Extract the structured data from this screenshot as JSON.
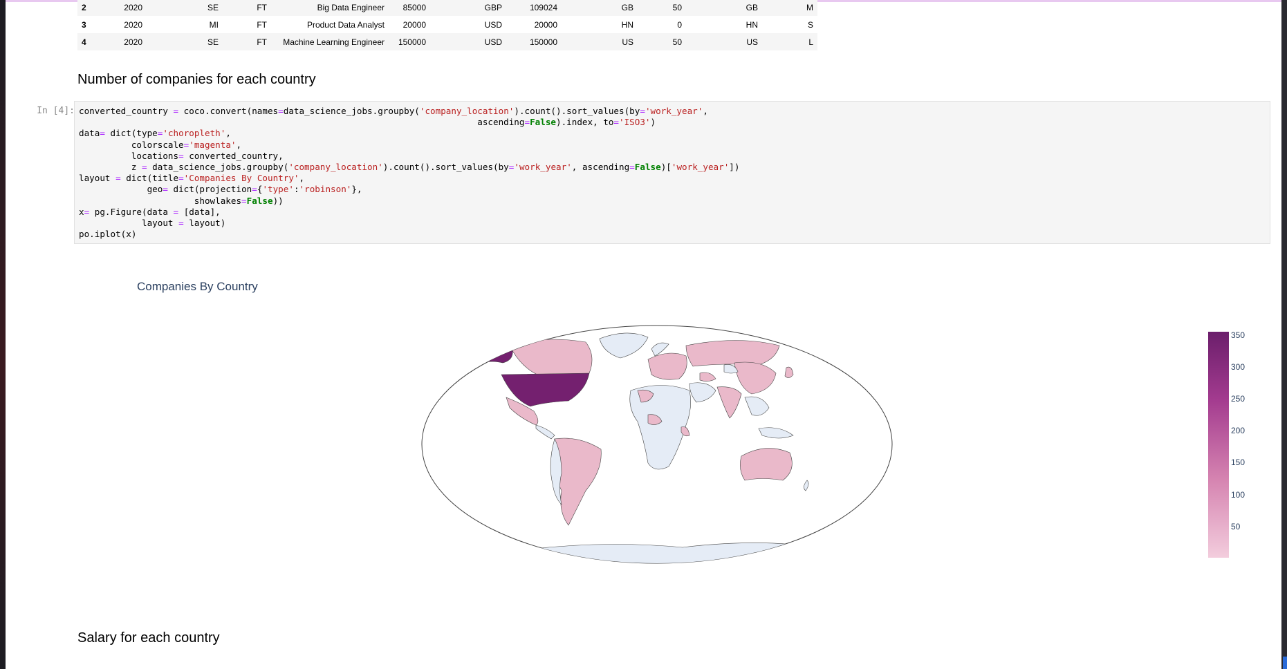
{
  "dataframe": {
    "rows": [
      [
        "2",
        "2020",
        "SE",
        "FT",
        "Big Data Engineer",
        "85000",
        "GBP",
        "109024",
        "GB",
        "50",
        "GB",
        "M"
      ],
      [
        "3",
        "2020",
        "MI",
        "FT",
        "Product Data Analyst",
        "20000",
        "USD",
        "20000",
        "HN",
        "0",
        "HN",
        "S"
      ],
      [
        "4",
        "2020",
        "SE",
        "FT",
        "Machine Learning Engineer",
        "150000",
        "USD",
        "150000",
        "US",
        "50",
        "US",
        "L"
      ]
    ]
  },
  "sections": {
    "companies_heading": "Number of companies for each country",
    "salary_heading": "Salary for each country"
  },
  "cell": {
    "prompt": "In [4]:"
  },
  "code_lines": [
    [
      [
        "converted_country ",
        ""
      ],
      [
        "=",
        "op"
      ],
      [
        " coco.convert(names",
        ""
      ],
      [
        "=",
        "op"
      ],
      [
        "data_science_jobs.groupby(",
        ""
      ],
      [
        "'company_location'",
        "st"
      ],
      [
        ").count().sort_values(by",
        ""
      ],
      [
        "=",
        "op"
      ],
      [
        "'work_year'",
        "st"
      ],
      [
        ",",
        ""
      ]
    ],
    [
      [
        "                                                                            ascending",
        ""
      ],
      [
        "=",
        "op"
      ],
      [
        "False",
        "kw"
      ],
      [
        ").index, to",
        ""
      ],
      [
        "=",
        "op"
      ],
      [
        "'ISO3'",
        "st"
      ],
      [
        ")",
        ""
      ]
    ],
    [
      [
        "data",
        ""
      ],
      [
        "=",
        "op"
      ],
      [
        " dict(type",
        ""
      ],
      [
        "=",
        "op"
      ],
      [
        "'choropleth'",
        "st"
      ],
      [
        ",",
        ""
      ]
    ],
    [
      [
        "          colorscale",
        ""
      ],
      [
        "=",
        "op"
      ],
      [
        "'magenta'",
        "st"
      ],
      [
        ",",
        ""
      ]
    ],
    [
      [
        "          locations",
        ""
      ],
      [
        "=",
        "op"
      ],
      [
        " converted_country,",
        ""
      ]
    ],
    [
      [
        "          z ",
        ""
      ],
      [
        "=",
        "op"
      ],
      [
        " data_science_jobs.groupby(",
        ""
      ],
      [
        "'company_location'",
        "st"
      ],
      [
        ").count().sort_values(by",
        ""
      ],
      [
        "=",
        "op"
      ],
      [
        "'work_year'",
        "st"
      ],
      [
        ", ascending",
        ""
      ],
      [
        "=",
        "op"
      ],
      [
        "False",
        "kw"
      ],
      [
        ")[",
        ""
      ],
      [
        "'work_year'",
        "st"
      ],
      [
        "])",
        ""
      ]
    ],
    [
      [
        "layout ",
        ""
      ],
      [
        "=",
        "op"
      ],
      [
        " dict(title",
        ""
      ],
      [
        "=",
        "op"
      ],
      [
        "'Companies By Country'",
        "st"
      ],
      [
        ",",
        ""
      ]
    ],
    [
      [
        "             geo",
        ""
      ],
      [
        "=",
        "op"
      ],
      [
        " dict(projection",
        ""
      ],
      [
        "=",
        "op"
      ],
      [
        "{",
        ""
      ],
      [
        "'type'",
        "st"
      ],
      [
        ":",
        ""
      ],
      [
        "'robinson'",
        "st"
      ],
      [
        "},",
        ""
      ]
    ],
    [
      [
        "                      showlakes",
        ""
      ],
      [
        "=",
        "op"
      ],
      [
        "False",
        "kw"
      ],
      [
        "))",
        ""
      ]
    ],
    [
      [
        "x",
        ""
      ],
      [
        "=",
        "op"
      ],
      [
        " pg.Figure(data ",
        ""
      ],
      [
        "=",
        "op"
      ],
      [
        " [data],",
        ""
      ]
    ],
    [
      [
        "            layout ",
        ""
      ],
      [
        "=",
        "op"
      ],
      [
        " layout)",
        ""
      ]
    ],
    [
      [
        "po.iplot(x)",
        ""
      ]
    ]
  ],
  "chart_data": {
    "type": "heatmap",
    "title": "Companies By Country",
    "projection": "robinson",
    "colorscale": "magenta",
    "colorbar_ticks": [
      "350",
      "300",
      "250",
      "200",
      "150",
      "100",
      "50"
    ],
    "colorbar_range": [
      1,
      355
    ],
    "highlighted_countries": {
      "USA": 355,
      "others_colored": "low values (approx. 1-50)"
    },
    "colors": {
      "max": "#6b1e6b",
      "low": "#eab9ca",
      "no_data": "#e5ecf6"
    }
  }
}
